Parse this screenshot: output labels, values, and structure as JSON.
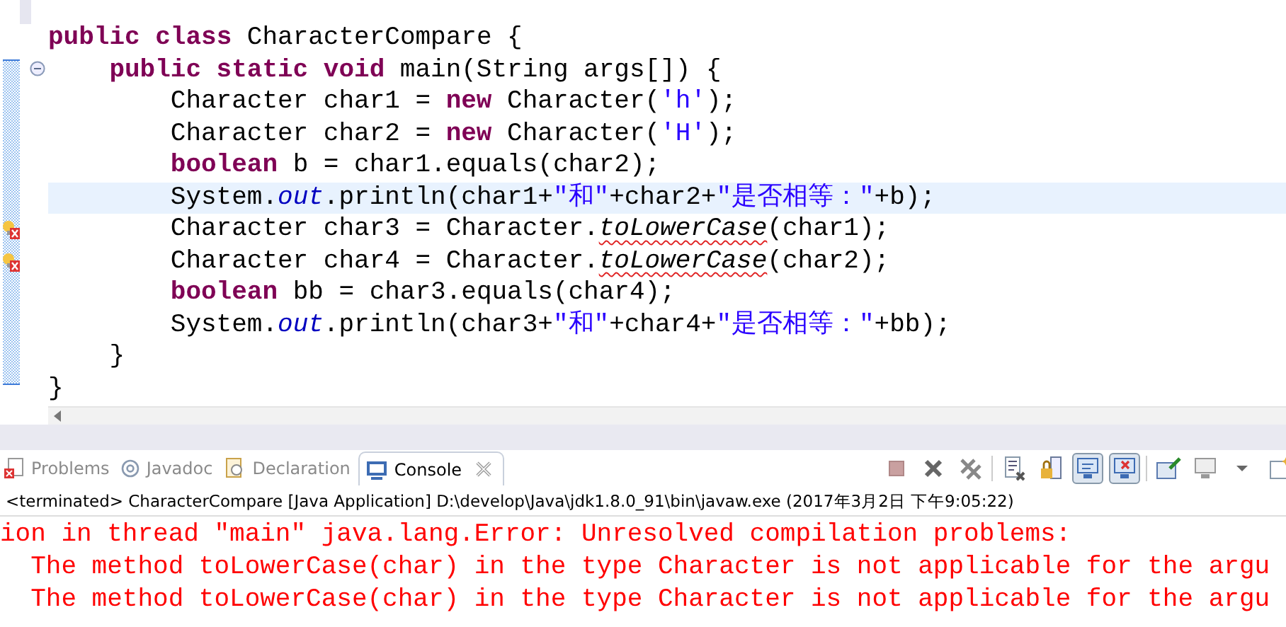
{
  "editor": {
    "lines": [
      {
        "current": false,
        "error": false,
        "foldable": false,
        "segments": [
          {
            "kind": "keyword",
            "text": "public class"
          },
          {
            "kind": "plain",
            "text": " CharacterCompare {"
          }
        ],
        "children": [
          {
            "current": false,
            "error": false,
            "foldable": true,
            "segments": [
              {
                "kind": "keyword",
                "text": "public static void"
              },
              {
                "kind": "plain",
                "text": " main(String args[]) {"
              }
            ],
            "children": [
              {
                "current": false,
                "error": false,
                "foldable": false,
                "segments": [
                  {
                    "kind": "plain",
                    "text": "Character char1 = "
                  },
                  {
                    "kind": "keyword",
                    "text": "new"
                  },
                  {
                    "kind": "plain",
                    "text": " Character("
                  },
                  {
                    "kind": "string",
                    "text": "'h'"
                  },
                  {
                    "kind": "plain",
                    "text": ");"
                  }
                ]
              },
              {
                "current": false,
                "error": false,
                "foldable": false,
                "segments": [
                  {
                    "kind": "plain",
                    "text": "Character char2 = "
                  },
                  {
                    "kind": "keyword",
                    "text": "new"
                  },
                  {
                    "kind": "plain",
                    "text": " Character("
                  },
                  {
                    "kind": "string",
                    "text": "'H'"
                  },
                  {
                    "kind": "plain",
                    "text": ");"
                  }
                ]
              },
              {
                "current": false,
                "error": false,
                "foldable": false,
                "segments": [
                  {
                    "kind": "keyword",
                    "text": "boolean"
                  },
                  {
                    "kind": "plain",
                    "text": " b = char1.equals(char2);"
                  }
                ]
              },
              {
                "current": true,
                "error": false,
                "foldable": false,
                "segments": [
                  {
                    "kind": "plain",
                    "text": "System."
                  },
                  {
                    "kind": "field",
                    "text": "out"
                  },
                  {
                    "kind": "plain",
                    "text": ".println(char1+"
                  },
                  {
                    "kind": "string",
                    "text": "\"和\""
                  },
                  {
                    "kind": "plain",
                    "text": "+char2+"
                  },
                  {
                    "kind": "string",
                    "text": "\"是否相等：\""
                  },
                  {
                    "kind": "plain",
                    "text": "+b);"
                  }
                ]
              },
              {
                "current": false,
                "error": true,
                "foldable": false,
                "segments": [
                  {
                    "kind": "plain",
                    "text": "Character char3 = Character."
                  },
                  {
                    "kind": "error_method",
                    "text": "toLowerCase"
                  },
                  {
                    "kind": "plain",
                    "text": "(char1);"
                  }
                ]
              },
              {
                "current": false,
                "error": true,
                "foldable": false,
                "segments": [
                  {
                    "kind": "plain",
                    "text": "Character char4 = Character."
                  },
                  {
                    "kind": "error_method",
                    "text": "toLowerCase"
                  },
                  {
                    "kind": "plain",
                    "text": "(char2);"
                  }
                ]
              },
              {
                "current": false,
                "error": false,
                "foldable": false,
                "segments": [
                  {
                    "kind": "keyword",
                    "text": "boolean"
                  },
                  {
                    "kind": "plain",
                    "text": " bb = char3.equals(char4);"
                  }
                ]
              },
              {
                "current": false,
                "error": false,
                "foldable": false,
                "segments": [
                  {
                    "kind": "plain",
                    "text": "System."
                  },
                  {
                    "kind": "field",
                    "text": "out"
                  },
                  {
                    "kind": "plain",
                    "text": ".println(char3+"
                  },
                  {
                    "kind": "string",
                    "text": "\"和\""
                  },
                  {
                    "kind": "plain",
                    "text": "+char4+"
                  },
                  {
                    "kind": "string",
                    "text": "\"是否相等：\""
                  },
                  {
                    "kind": "plain",
                    "text": "+bb);"
                  }
                ]
              }
            ]
          },
          {
            "current": false,
            "error": false,
            "foldable": false,
            "segments": [
              {
                "kind": "plain",
                "text": "}"
              }
            ]
          }
        ]
      },
      {
        "current": false,
        "error": false,
        "foldable": false,
        "segments": [
          {
            "kind": "plain",
            "text": "}"
          }
        ]
      }
    ]
  },
  "tabs": [
    {
      "label": "Problems",
      "selected": false,
      "closable": false
    },
    {
      "label": "Javadoc",
      "selected": false,
      "closable": false
    },
    {
      "label": "Declaration",
      "selected": false,
      "closable": false
    },
    {
      "label": "Console",
      "selected": true,
      "closable": true
    }
  ],
  "toolbar": [
    {
      "pressed": false
    },
    {
      "pressed": false
    },
    {
      "pressed": false
    },
    {
      "pressed": false
    },
    {
      "pressed": false
    },
    {
      "pressed": true
    },
    {
      "pressed": true
    },
    {
      "pressed": false
    },
    {
      "pressed": false
    },
    {
      "pressed": false
    },
    {
      "pressed": false
    }
  ],
  "console": {
    "header": "<terminated> CharacterCompare [Java Application] D:\\develop\\Java\\jdk1.8.0_91\\bin\\javaw.exe (2017年3月2日 下午9:05:22)",
    "lines": [
      "ion in thread \"main\" java.lang.Error: Unresolved compilation problems:",
      "  The method toLowerCase(char) in the type Character is not applicable for the argu",
      "  The method toLowerCase(char) in the type Character is not applicable for the argu"
    ]
  }
}
